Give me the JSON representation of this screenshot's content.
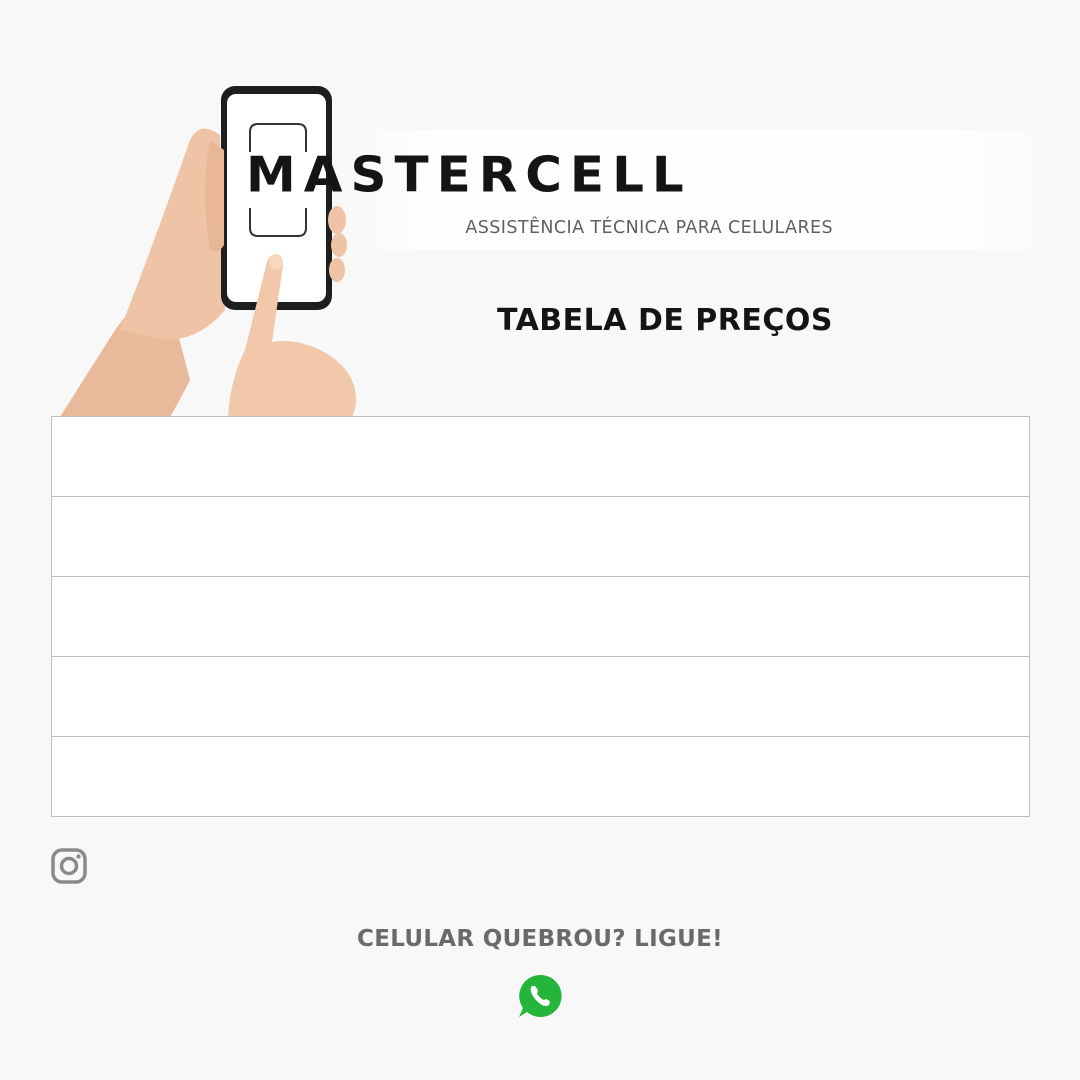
{
  "brand": {
    "name": "MASTERCELL",
    "tagline": "ASSISTÊNCIA TÉCNICA PARA CELULARES",
    "logo_icon": "phone-frame-icon"
  },
  "page_title": "TABELA DE PREÇOS",
  "hero": {
    "icon": "hand-holding-phone"
  },
  "price_table": {
    "rows": [
      "",
      "",
      "",
      "",
      ""
    ]
  },
  "social": {
    "instagram_icon": "instagram-icon"
  },
  "cta": {
    "text": "CELULAR QUEBROU? LIGUE!",
    "icon": "whatsapp-icon",
    "icon_color": "#25b53a"
  },
  "colors": {
    "background": "#f8f8f8",
    "text_dark": "#141414",
    "text_muted": "#606060",
    "table_border": "#bdbdbd"
  }
}
